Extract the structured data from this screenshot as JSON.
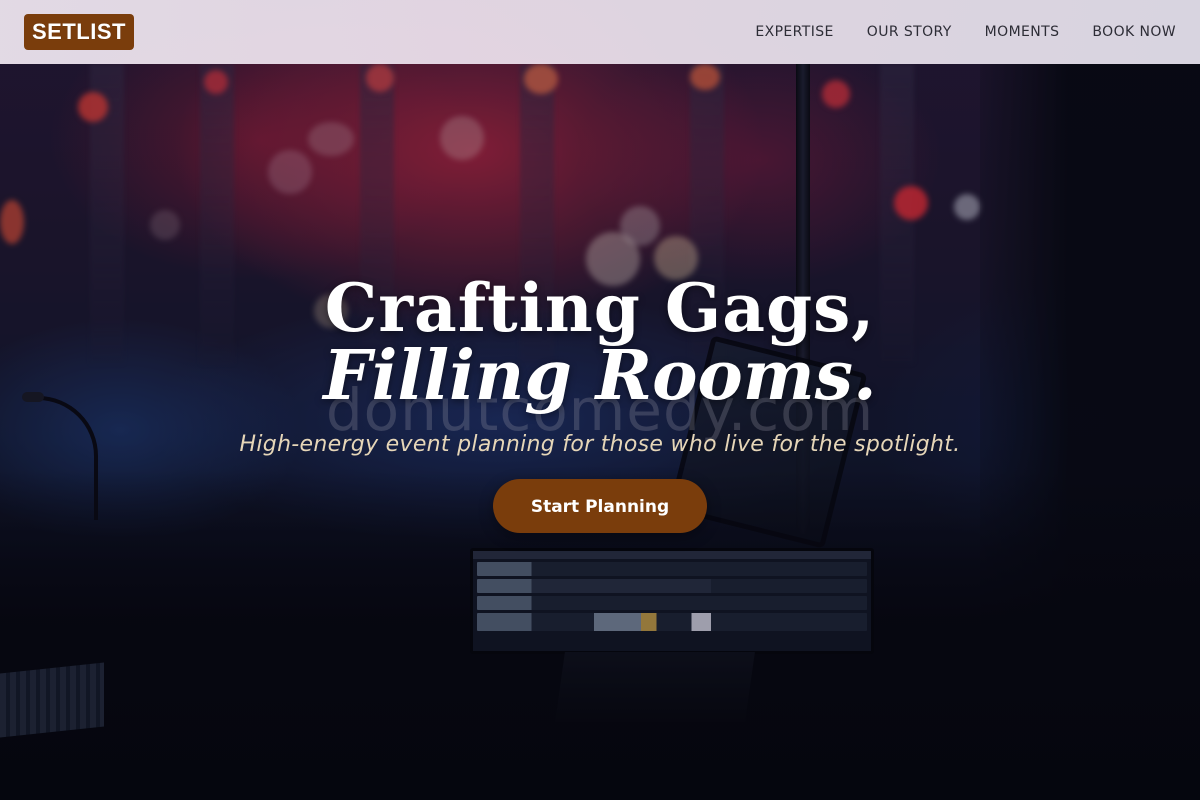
{
  "brand": {
    "logo_text": "SETLIST",
    "logo_color": "#7a3d0c"
  },
  "nav": {
    "items": [
      {
        "label": "EXPERTISE"
      },
      {
        "label": "OUR STORY"
      },
      {
        "label": "MOMENTS"
      },
      {
        "label": "BOOK NOW"
      }
    ]
  },
  "hero": {
    "headline_line1": "Crafting Gags,",
    "headline_line2": "Filling Rooms.",
    "tagline": "High-energy event planning for those who live for the spotlight.",
    "cta_label": "Start Planning",
    "watermark": "donutcomedy.com",
    "background_image": "concert-stage-mixing-desk-photo"
  },
  "colors": {
    "accent": "#7a3d0c",
    "tagline": "#e6d6b8",
    "header_bg": "#ebe2ec",
    "nav_text": "#2d2d36"
  }
}
